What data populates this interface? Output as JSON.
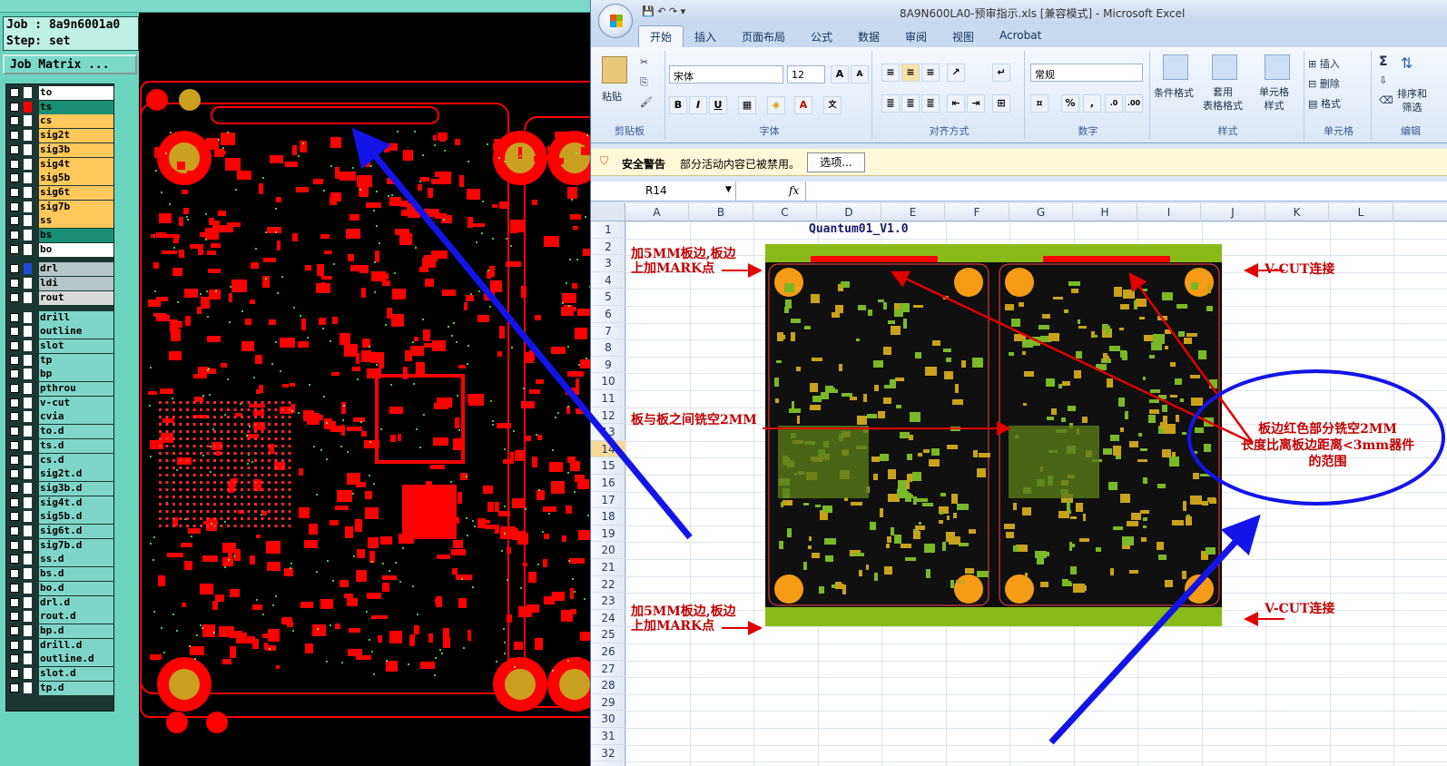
{
  "cam": {
    "job_label": "Job : 8a9n6001a0",
    "step_label": "Step: set",
    "job_matrix_button": "Job Matrix ...",
    "layers": [
      {
        "name": "to",
        "bg": "#ffffff",
        "sw": "#ffffff"
      },
      {
        "name": "ts",
        "bg": "#1a8f74",
        "sw": "#ff0000"
      },
      {
        "name": "cs",
        "bg": "#ffc85a",
        "sw": "#ffffff"
      },
      {
        "name": "sig2t",
        "bg": "#ffc85a",
        "sw": "#ffffff"
      },
      {
        "name": "sig3b",
        "bg": "#ffc85a",
        "sw": "#ffffff"
      },
      {
        "name": "sig4t",
        "bg": "#ffc85a",
        "sw": "#ffffff"
      },
      {
        "name": "sig5b",
        "bg": "#ffc85a",
        "sw": "#ffffff"
      },
      {
        "name": "sig6t",
        "bg": "#ffc85a",
        "sw": "#ffffff"
      },
      {
        "name": "sig7b",
        "bg": "#ffc85a",
        "sw": "#ffffff"
      },
      {
        "name": "ss",
        "bg": "#ffc85a",
        "sw": "#ffffff"
      },
      {
        "name": "bs",
        "bg": "#1a8f74",
        "sw": "#ffffff"
      },
      {
        "name": "bo",
        "bg": "#ffffff",
        "sw": "#ffffff"
      },
      {
        "name": "drl",
        "bg": "#b6c6c8",
        "sw": "#1d4fd8",
        "gap": true
      },
      {
        "name": "ldi",
        "bg": "#b6c6c8",
        "sw": "#ffffff"
      },
      {
        "name": "rout",
        "bg": "#d9d9d9",
        "sw": "#ffffff"
      },
      {
        "name": "drill",
        "bg": "#7fd6c8",
        "sw": "#ffffff",
        "gap": true
      },
      {
        "name": "outline",
        "bg": "#7fd6c8",
        "sw": "#ffffff"
      },
      {
        "name": "slot",
        "bg": "#7fd6c8",
        "sw": "#ffffff"
      },
      {
        "name": "tp",
        "bg": "#7fd6c8",
        "sw": "#ffffff"
      },
      {
        "name": "bp",
        "bg": "#7fd6c8",
        "sw": "#ffffff"
      },
      {
        "name": "pthrou",
        "bg": "#7fd6c8",
        "sw": "#ffffff"
      },
      {
        "name": "v-cut",
        "bg": "#7fd6c8",
        "sw": "#ffffff"
      },
      {
        "name": "cvia",
        "bg": "#7fd6c8",
        "sw": "#ffffff"
      },
      {
        "name": "to.d",
        "bg": "#7fd6c8",
        "sw": "#ffffff"
      },
      {
        "name": "ts.d",
        "bg": "#7fd6c8",
        "sw": "#ffffff"
      },
      {
        "name": "cs.d",
        "bg": "#7fd6c8",
        "sw": "#ffffff"
      },
      {
        "name": "sig2t.d",
        "bg": "#7fd6c8",
        "sw": "#ffffff"
      },
      {
        "name": "sig3b.d",
        "bg": "#7fd6c8",
        "sw": "#ffffff"
      },
      {
        "name": "sig4t.d",
        "bg": "#7fd6c8",
        "sw": "#ffffff"
      },
      {
        "name": "sig5b.d",
        "bg": "#7fd6c8",
        "sw": "#ffffff"
      },
      {
        "name": "sig6t.d",
        "bg": "#7fd6c8",
        "sw": "#ffffff"
      },
      {
        "name": "sig7b.d",
        "bg": "#7fd6c8",
        "sw": "#ffffff"
      },
      {
        "name": "ss.d",
        "bg": "#7fd6c8",
        "sw": "#ffffff"
      },
      {
        "name": "bs.d",
        "bg": "#7fd6c8",
        "sw": "#ffffff"
      },
      {
        "name": "bo.d",
        "bg": "#7fd6c8",
        "sw": "#ffffff"
      },
      {
        "name": "drl.d",
        "bg": "#7fd6c8",
        "sw": "#ffffff"
      },
      {
        "name": "rout.d",
        "bg": "#7fd6c8",
        "sw": "#ffffff"
      },
      {
        "name": "bp.d",
        "bg": "#7fd6c8",
        "sw": "#ffffff"
      },
      {
        "name": "drill.d",
        "bg": "#7fd6c8",
        "sw": "#ffffff"
      },
      {
        "name": "outline.d",
        "bg": "#7fd6c8",
        "sw": "#ffffff"
      },
      {
        "name": "slot.d",
        "bg": "#7fd6c8",
        "sw": "#ffffff"
      },
      {
        "name": "tp.d",
        "bg": "#7fd6c8",
        "sw": "#ffffff"
      }
    ]
  },
  "excel": {
    "window_title": "8A9N600LA0-预审指示.xls  [兼容模式] - Microsoft Excel",
    "tabs": [
      "开始",
      "插入",
      "页面布局",
      "公式",
      "数据",
      "审阅",
      "视图",
      "Acrobat"
    ],
    "ribbon": {
      "clipboard": {
        "paste": "粘贴",
        "label": "剪贴板"
      },
      "font": {
        "name": "宋体",
        "size": "12",
        "label": "字体",
        "bold": "B",
        "italic": "I",
        "underline": "U"
      },
      "alignment": {
        "label": "对齐方式"
      },
      "number": {
        "format": "常规",
        "label": "数字",
        "percent": "%",
        "comma": ","
      },
      "styles": {
        "cond": "条件格式",
        "table": "套用\n表格格式",
        "cell": "单元格\n样式",
        "label": "样式"
      },
      "cells": {
        "insert": "插入",
        "delete": "删除",
        "format": "格式",
        "label": "单元格"
      },
      "editing": {
        "sort": "排序和\n筛选",
        "label": "编辑"
      }
    },
    "security_bar": {
      "title": "安全警告",
      "message": "部分活动内容已被禁用。",
      "options_button": "选项..."
    },
    "name_box": "R14",
    "fx": "fx",
    "columns": [
      "A",
      "B",
      "C",
      "D",
      "E",
      "F",
      "G",
      "H",
      "I",
      "J",
      "K",
      "L"
    ],
    "rows": [
      "1",
      "2",
      "3",
      "4",
      "5",
      "6",
      "7",
      "8",
      "9",
      "10",
      "11",
      "12",
      "13",
      "14",
      "15",
      "16",
      "17",
      "18",
      "19",
      "20",
      "21",
      "22",
      "23",
      "24",
      "25",
      "26",
      "27",
      "28",
      "29",
      "30",
      "31",
      "32"
    ],
    "selected_row": "14",
    "sheet_title": "Quantum01_V1.0",
    "notes": {
      "top_left": "加5MM板边,板边\n上加MARK点",
      "top_right": "V-CUT连接",
      "middle_left": "板与板之间铣空2MM",
      "right_main": "板边红色部分铣空2MM\n长度比离板边距离<3mm器件\n的范围",
      "bottom_left": "加5MM板边,板边\n上加MARK点",
      "bottom_right": "V-CUT连接"
    }
  }
}
